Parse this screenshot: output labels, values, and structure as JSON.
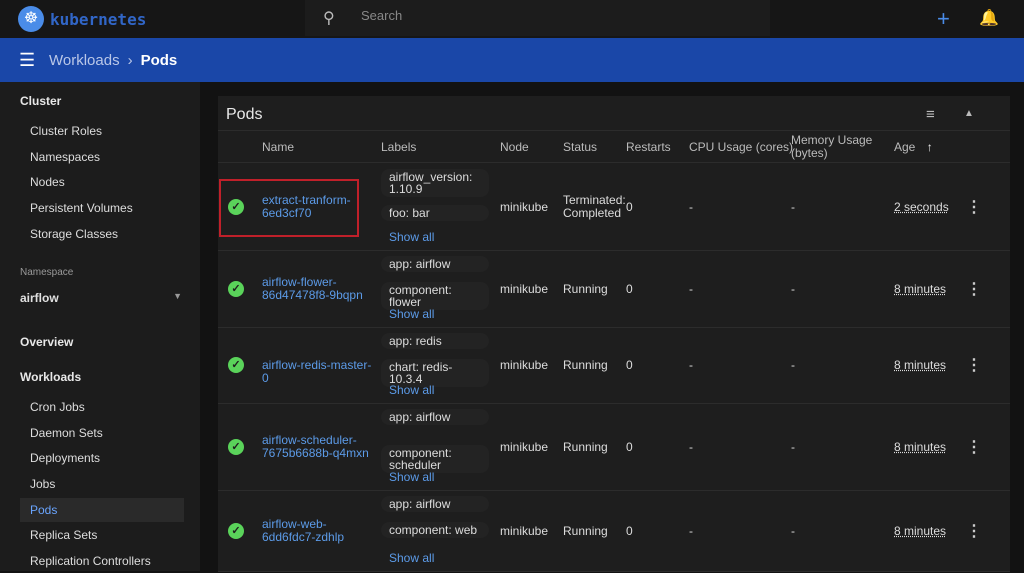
{
  "header": {
    "brand": "kubernetes",
    "search_placeholder": "Search",
    "plus": "+",
    "bell": "🔔"
  },
  "breadcrumb": {
    "parent": "Workloads",
    "sep": "›",
    "current": "Pods"
  },
  "sidebar": {
    "cluster": "Cluster",
    "cluster_items": [
      "Cluster Roles",
      "Namespaces",
      "Nodes",
      "Persistent Volumes",
      "Storage Classes"
    ],
    "namespace_label": "Namespace",
    "namespace": "airflow",
    "overview": "Overview",
    "workloads": "Workloads",
    "workload_items": [
      "Cron Jobs",
      "Daemon Sets",
      "Deployments",
      "Jobs",
      "Pods",
      "Replica Sets",
      "Replication Controllers"
    ]
  },
  "table": {
    "title": "Pods",
    "columns": [
      "Name",
      "Labels",
      "Node",
      "Status",
      "Restarts",
      "CPU Usage (cores)",
      "Memory Usage (bytes)",
      "Age"
    ],
    "sort_icon": "↑",
    "show_all": "Show all",
    "rows": [
      {
        "name": "extract-tranform-6ed3cf70",
        "labels": [
          "airflow_version: 1.10.9",
          "foo: bar"
        ],
        "node": "minikube",
        "status": "Terminated: Completed",
        "restarts": "0",
        "cpu": "-",
        "mem": "-",
        "age": "2 seconds"
      },
      {
        "name": "airflow-flower-86d47478f8-9bqpn",
        "labels": [
          "app: airflow",
          "component: flower"
        ],
        "node": "minikube",
        "status": "Running",
        "restarts": "0",
        "cpu": "-",
        "mem": "-",
        "age": "8 minutes"
      },
      {
        "name": "airflow-redis-master-0",
        "labels": [
          "app: redis",
          "chart: redis-10.3.4"
        ],
        "node": "minikube",
        "status": "Running",
        "restarts": "0",
        "cpu": "-",
        "mem": "-",
        "age": "8 minutes"
      },
      {
        "name": "airflow-scheduler-7675b6688b-q4mxn",
        "labels": [
          "app: airflow",
          "component: scheduler"
        ],
        "node": "minikube",
        "status": "Running",
        "restarts": "0",
        "cpu": "-",
        "mem": "-",
        "age": "8 minutes"
      },
      {
        "name": "airflow-web-6dd6fdc7-zdhlp",
        "labels": [
          "app: airflow",
          "component: web"
        ],
        "node": "minikube",
        "status": "Running",
        "restarts": "0",
        "cpu": "-",
        "mem": "-",
        "age": "8 minutes"
      }
    ]
  }
}
